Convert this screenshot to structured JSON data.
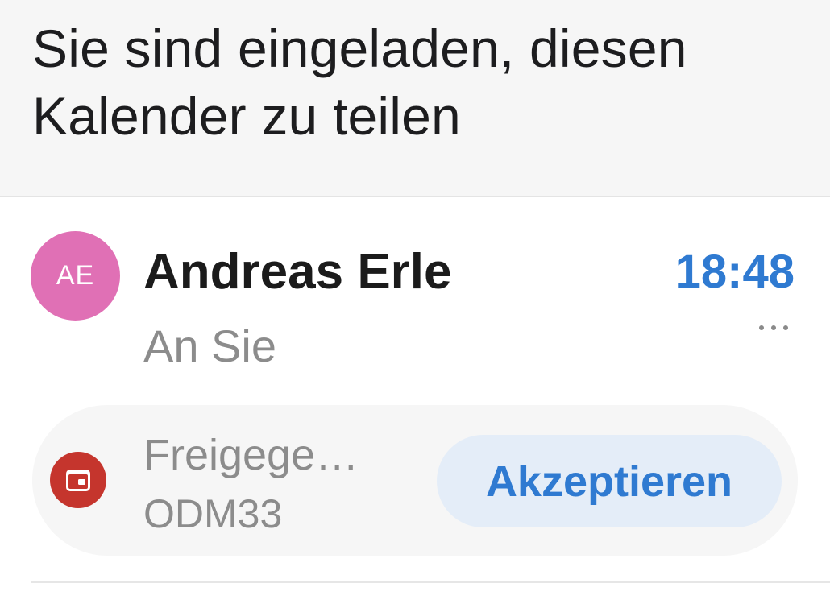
{
  "subject": {
    "title": "Sie sind eingeladen, diesen Kalender zu teilen"
  },
  "message": {
    "sender": {
      "initials": "AE",
      "name": "Andreas Erle",
      "avatar_color": "#e070b5"
    },
    "time": "18:48",
    "recipient": "An Sie",
    "more_icon": "ellipsis-icon"
  },
  "invite": {
    "calendar_icon": "calendar-icon",
    "calendar_icon_color": "#c5352d",
    "calendar_name": "Freigege…",
    "calendar_owner": "ODM33",
    "accept_label": "Akzeptieren",
    "accent_color": "#2f7ad1"
  }
}
